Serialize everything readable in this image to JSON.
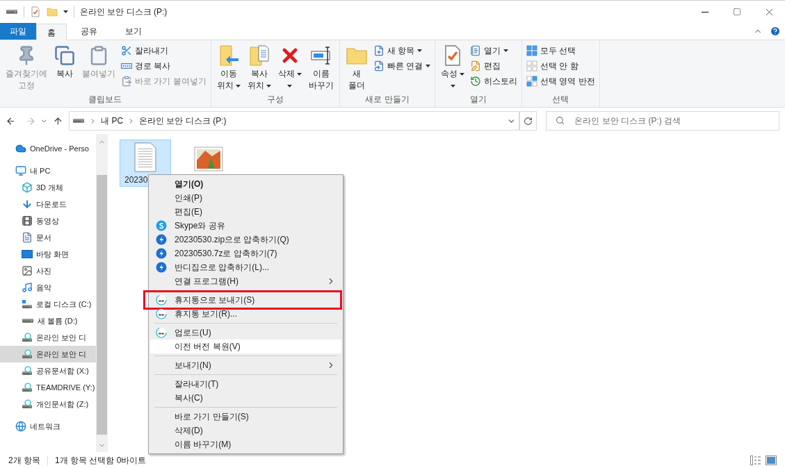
{
  "window": {
    "title": "온라인 보안 디스크 (P:)"
  },
  "ribbon_tabs": [
    {
      "label": "파일",
      "kind": "file",
      "selected": false
    },
    {
      "label": "홈",
      "kind": "tab",
      "selected": true
    },
    {
      "label": "공유",
      "kind": "tab",
      "selected": false
    },
    {
      "label": "보기",
      "kind": "tab",
      "selected": false
    }
  ],
  "ribbon": {
    "groups": [
      {
        "label": "클립보드",
        "columns": [
          {
            "kind": "large",
            "lines": [
              "즐겨찾기에",
              "고정"
            ],
            "disabled": true,
            "dropdown": false
          },
          {
            "kind": "large",
            "lines": [
              "복사"
            ],
            "disabled": false,
            "dropdown": false
          },
          {
            "kind": "large",
            "lines": [
              "붙여넣기"
            ],
            "disabled": true,
            "dropdown": false
          },
          {
            "kind": "stack",
            "items": [
              {
                "label": "잘라내기",
                "disabled": false,
                "dropdown": false
              },
              {
                "label": "경로 복사",
                "disabled": false,
                "dropdown": false
              },
              {
                "label": "바로 가기 붙여넣기",
                "disabled": true,
                "dropdown": false
              }
            ]
          }
        ]
      },
      {
        "label": "구성",
        "columns": [
          {
            "kind": "large",
            "lines": [
              "이동",
              "위치"
            ],
            "disabled": false,
            "dropdown": true
          },
          {
            "kind": "large",
            "lines": [
              "복사",
              "위치"
            ],
            "disabled": false,
            "dropdown": true
          },
          {
            "kind": "large",
            "lines": [
              "삭제"
            ],
            "disabled": false,
            "dropdown": true
          },
          {
            "kind": "large",
            "lines": [
              "이름",
              "바꾸기"
            ],
            "disabled": false,
            "dropdown": false
          }
        ]
      },
      {
        "label": "새로 만들기",
        "columns": [
          {
            "kind": "large",
            "lines": [
              "새",
              "폴더"
            ],
            "disabled": false,
            "dropdown": false
          },
          {
            "kind": "stack",
            "items": [
              {
                "label": "새 항목",
                "disabled": false,
                "dropdown": true
              },
              {
                "label": "빠른 연결",
                "disabled": false,
                "dropdown": true
              }
            ]
          }
        ]
      },
      {
        "label": "열기",
        "columns": [
          {
            "kind": "large",
            "lines": [
              "속성"
            ],
            "disabled": false,
            "dropdown": true
          },
          {
            "kind": "stack",
            "items": [
              {
                "label": "열기",
                "disabled": false,
                "dropdown": true
              },
              {
                "label": "편집",
                "disabled": false,
                "dropdown": false
              },
              {
                "label": "히스토리",
                "disabled": false,
                "dropdown": false
              }
            ]
          }
        ]
      },
      {
        "label": "선택",
        "columns": [
          {
            "kind": "stack",
            "items": [
              {
                "label": "모두 선택",
                "disabled": false,
                "dropdown": false
              },
              {
                "label": "선택 안 함",
                "disabled": false,
                "dropdown": false
              },
              {
                "label": "선택 영역 반전",
                "disabled": false,
                "dropdown": false
              }
            ]
          }
        ]
      }
    ]
  },
  "address_bar": {
    "path": [
      "내 PC",
      "온라인 보안 디스크 (P:)"
    ]
  },
  "search": {
    "placeholder": "온라인 보안 디스크 (P:) 검색"
  },
  "sidebar": {
    "items": [
      {
        "label": "OneDrive - Perso",
        "selected": false
      },
      {
        "label": "내 PC",
        "selected": false,
        "children": [
          {
            "label": "3D 개체",
            "selected": false
          },
          {
            "label": "다운로드",
            "selected": false
          },
          {
            "label": "동영상",
            "selected": false
          },
          {
            "label": "문서",
            "selected": false
          },
          {
            "label": "바탕 화면",
            "selected": false
          },
          {
            "label": "사진",
            "selected": false
          },
          {
            "label": "음악",
            "selected": false
          },
          {
            "label": "로컬 디스크 (C:)",
            "selected": false
          },
          {
            "label": "새 볼륨 (D:)",
            "selected": false
          },
          {
            "label": "온라인 보안 디",
            "selected": false
          },
          {
            "label": "온라인 보안 디",
            "selected": true
          },
          {
            "label": "공유문서함 (X:)",
            "selected": false
          },
          {
            "label": "TEAMDRIVE (Y:)",
            "selected": false
          },
          {
            "label": "개인문서함 (Z:)",
            "selected": false
          }
        ]
      },
      {
        "label": "네트워크",
        "selected": false
      }
    ]
  },
  "files": [
    {
      "name": "20230",
      "kind": "text",
      "selected": true
    },
    {
      "kind": "image",
      "selected": false
    }
  ],
  "context_menu": {
    "items": [
      {
        "kind": "plain",
        "label": "열기(O)",
        "default": true,
        "submenu": false,
        "hovered": false,
        "annotated": false
      },
      {
        "kind": "plain",
        "label": "인쇄(P)",
        "default": false,
        "submenu": false,
        "hovered": false,
        "annotated": false
      },
      {
        "kind": "plain",
        "label": "편집(E)",
        "default": false,
        "submenu": false,
        "hovered": false,
        "annotated": false
      },
      {
        "kind": "share",
        "label": "Skype와 공유",
        "default": false,
        "submenu": false,
        "hovered": false,
        "annotated": false
      },
      {
        "kind": "archive",
        "label": "20230530.zip으로 압축하기(Q)",
        "default": false,
        "submenu": false,
        "hovered": false,
        "annotated": false
      },
      {
        "kind": "archive",
        "label": "20230530.7z로 압축하기(7)",
        "default": false,
        "submenu": false,
        "hovered": false,
        "annotated": false
      },
      {
        "kind": "archive",
        "label": "반디집으로 압축하기(L)...",
        "default": false,
        "submenu": false,
        "hovered": false,
        "annotated": false
      },
      {
        "kind": "plain",
        "label": "연결 프로그램(H)",
        "default": false,
        "submenu": true,
        "hovered": false,
        "annotated": false
      },
      {
        "kind": "separator"
      },
      {
        "kind": "cloud",
        "label": "휴지통으로 보내기(S)",
        "default": false,
        "submenu": false,
        "hovered": false,
        "annotated": true
      },
      {
        "kind": "cloud",
        "label": "휴지통 보기(R)...",
        "default": false,
        "submenu": false,
        "hovered": false,
        "annotated": false
      },
      {
        "kind": "separator"
      },
      {
        "kind": "cloud",
        "label": "업로드(U)",
        "default": false,
        "submenu": false,
        "hovered": false,
        "annotated": false
      },
      {
        "kind": "plain",
        "label": "이전 버전 복원(V)",
        "default": false,
        "submenu": false,
        "hovered": true,
        "annotated": false
      },
      {
        "kind": "separator"
      },
      {
        "kind": "plain",
        "label": "보내기(N)",
        "default": false,
        "submenu": true,
        "hovered": false,
        "annotated": false
      },
      {
        "kind": "separator"
      },
      {
        "kind": "plain",
        "label": "잘라내기(T)",
        "default": false,
        "submenu": false,
        "hovered": false,
        "annotated": false
      },
      {
        "kind": "plain",
        "label": "복사(C)",
        "default": false,
        "submenu": false,
        "hovered": false,
        "annotated": false
      },
      {
        "kind": "separator"
      },
      {
        "kind": "plain",
        "label": "바로 가기 만들기(S)",
        "default": false,
        "submenu": false,
        "hovered": false,
        "annotated": false
      },
      {
        "kind": "plain",
        "label": "삭제(D)",
        "default": false,
        "submenu": false,
        "hovered": false,
        "annotated": false
      },
      {
        "kind": "plain",
        "label": "이름 바꾸기(M)",
        "default": false,
        "submenu": false,
        "hovered": false,
        "annotated": false
      }
    ]
  },
  "status_bar": {
    "count": "2개 항목",
    "selection": "1개 항목 선택함 0바이트"
  }
}
